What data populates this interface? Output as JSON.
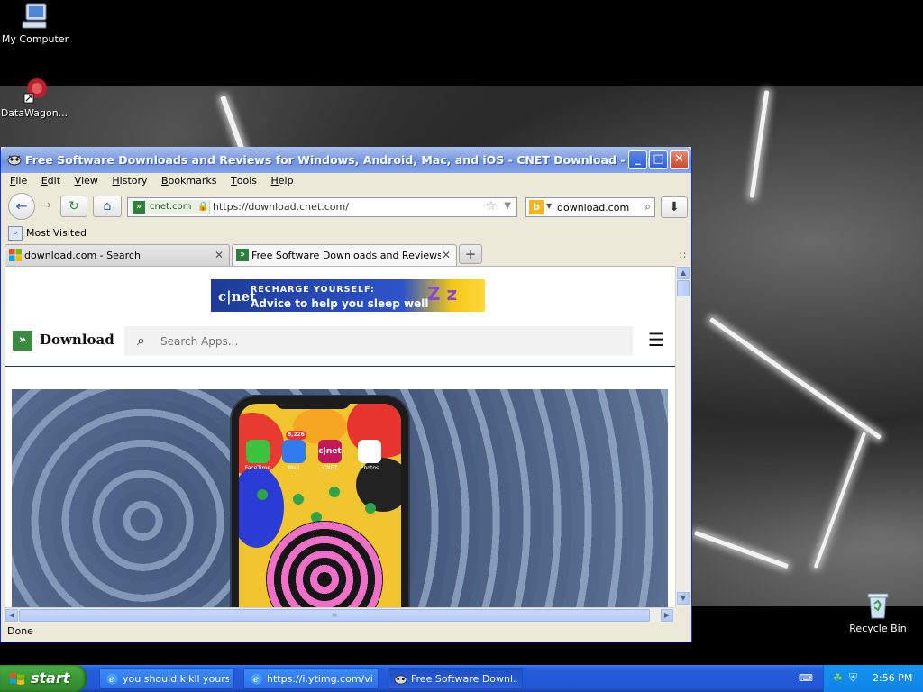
{
  "desktop": {
    "icons": [
      {
        "label": "My Computer",
        "icon": "computer-icon"
      },
      {
        "label": "DataWagon...",
        "icon": "datawagon-icon"
      },
      {
        "label": "Recycle Bin",
        "icon": "recycle-bin-icon"
      }
    ]
  },
  "window": {
    "title": "Free Software Downloads and Reviews for Windows, Android, Mac, and iOS - CNET Download - Mypal",
    "buttons": {
      "minimize": "_",
      "maximize": "□",
      "close": "✕"
    },
    "menu": [
      "File",
      "Edit",
      "View",
      "History",
      "Bookmarks",
      "Tools",
      "Help"
    ],
    "menu_access_keys": [
      "F",
      "E",
      "V",
      "H",
      "B",
      "T",
      "H"
    ],
    "toolbar": {
      "site_identity": "cnet.com",
      "url": "https://download.cnet.com/",
      "search_value": "download.com",
      "search_engine_icon": "b"
    },
    "bookmarks_toolbar": {
      "item": "Most Visited"
    },
    "tabs": [
      {
        "label": "download.com - Search",
        "active": false
      },
      {
        "label": "Free Software Downloads and Reviews f...",
        "active": true
      }
    ],
    "new_tab": "+",
    "status": "Done"
  },
  "page": {
    "ad": {
      "brand": "c|net",
      "line1": "RECHARGE YOURSELF:",
      "line2": "Advice to help you sleep well",
      "deco": "Z z"
    },
    "header": {
      "brand": "Download",
      "search_placeholder": "Search Apps..."
    },
    "hero": {
      "apps": [
        {
          "name": "FaceTime",
          "color": "#3bc23e"
        },
        {
          "name": "Mail",
          "color": "#2f7bef",
          "badge": "8,226"
        },
        {
          "name": "CNET",
          "color": "#c2185b",
          "text": "c|net"
        },
        {
          "name": "Photos",
          "color": "#ffffff"
        }
      ]
    }
  },
  "taskbar": {
    "start_label": "start",
    "tasks": [
      {
        "label": "you should kikll yours...",
        "icon": "ie-icon"
      },
      {
        "label": "https://i.ytimg.com/vi...",
        "icon": "ie-icon"
      },
      {
        "label": "Free Software Downl...",
        "icon": "mypal-icon",
        "active": true
      }
    ],
    "clock": "2:56 PM"
  },
  "colors": {
    "accent": "#3a8a3f",
    "titlebar": "#7f9ee2",
    "taskbar": "#245ddb"
  }
}
